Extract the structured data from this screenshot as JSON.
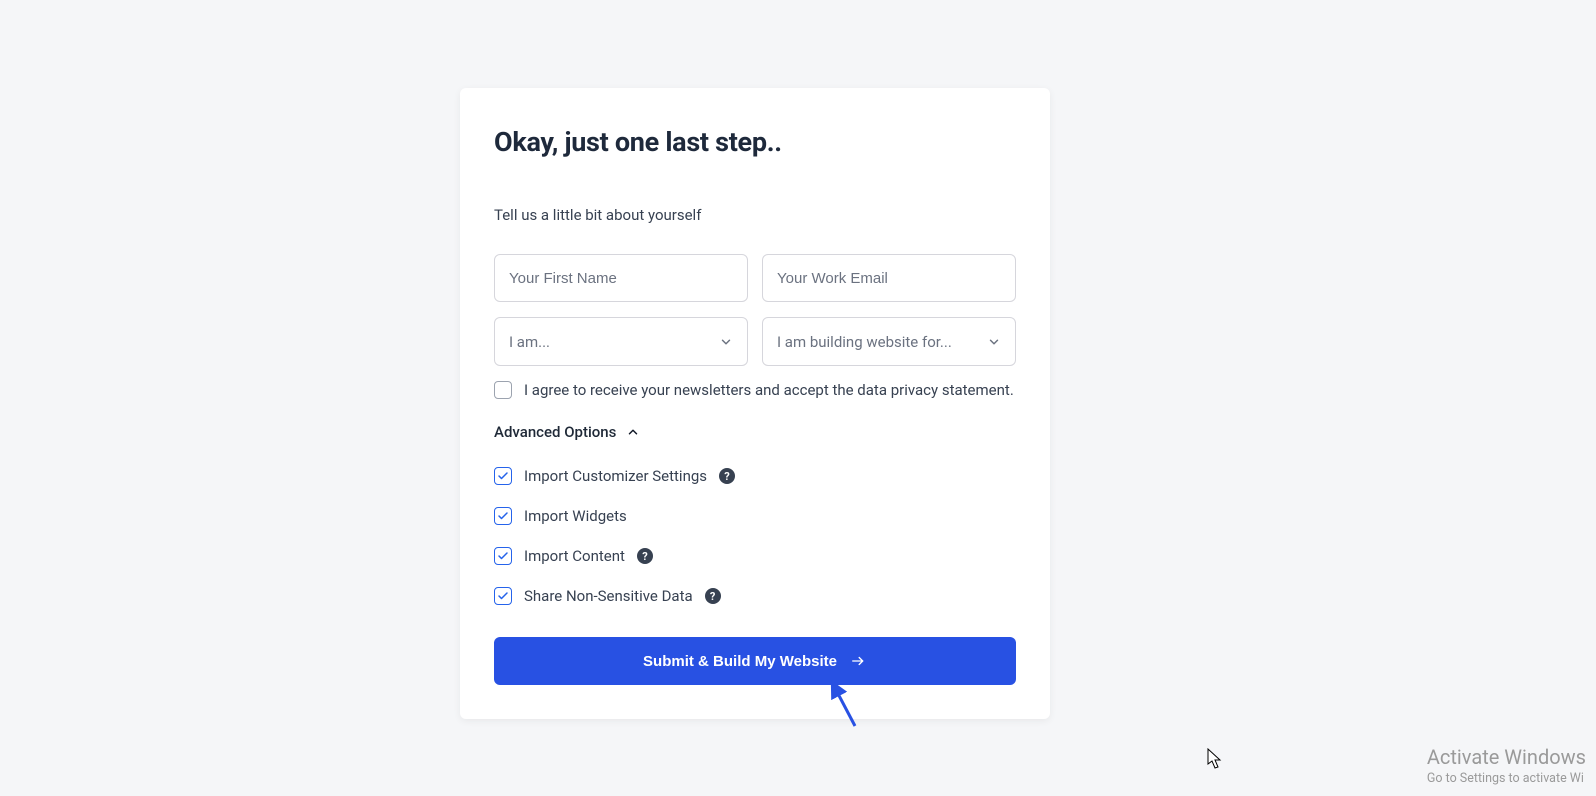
{
  "card": {
    "title": "Okay, just one last step..",
    "subtitle": "Tell us a little bit about yourself",
    "first_name_placeholder": "Your First Name",
    "email_placeholder": "Your Work Email",
    "role_select_label": "I am...",
    "building_for_label": "I am building website for...",
    "consent_text": "I agree to receive your newsletters and accept the data privacy statement.",
    "advanced_label": "Advanced Options",
    "options": [
      {
        "label": "Import Customizer Settings",
        "help": true,
        "checked": true
      },
      {
        "label": "Import Widgets",
        "help": false,
        "checked": true
      },
      {
        "label": "Import Content",
        "help": true,
        "checked": true
      },
      {
        "label": "Share Non-Sensitive Data",
        "help": true,
        "checked": true
      }
    ],
    "submit_label": "Submit & Build My Website"
  },
  "watermark": {
    "title": "Activate Windows",
    "sub": "Go to Settings to activate Wi"
  }
}
